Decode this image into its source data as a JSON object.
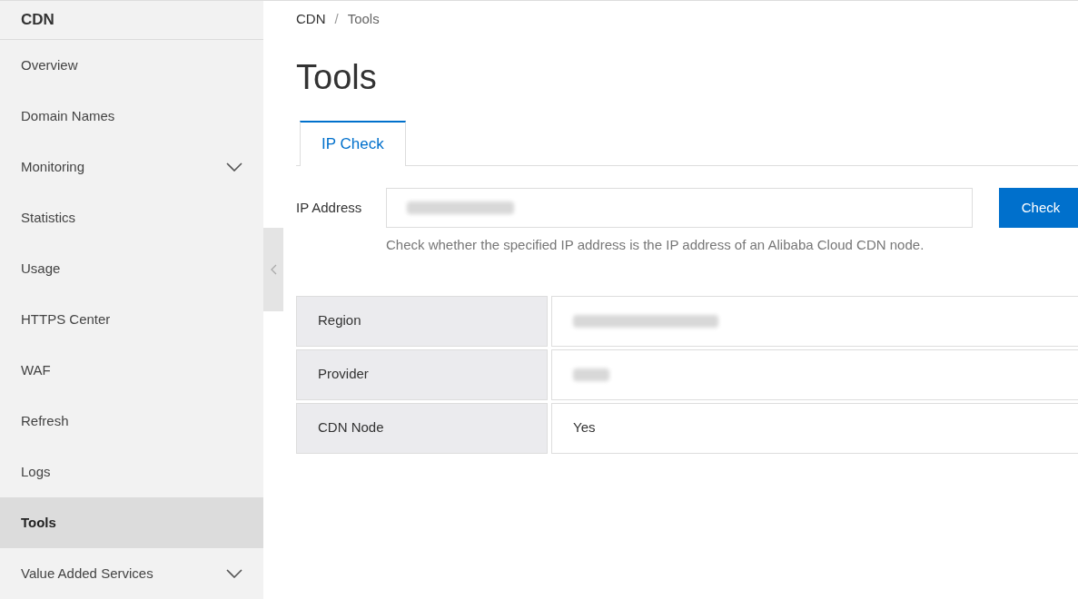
{
  "sidebar": {
    "title": "CDN",
    "items": [
      {
        "label": "Overview",
        "selected": false,
        "expandable": false
      },
      {
        "label": "Domain Names",
        "selected": false,
        "expandable": false
      },
      {
        "label": "Monitoring",
        "selected": false,
        "expandable": true
      },
      {
        "label": "Statistics",
        "selected": false,
        "expandable": false
      },
      {
        "label": "Usage",
        "selected": false,
        "expandable": false
      },
      {
        "label": "HTTPS Center",
        "selected": false,
        "expandable": false
      },
      {
        "label": "WAF",
        "selected": false,
        "expandable": false
      },
      {
        "label": "Refresh",
        "selected": false,
        "expandable": false
      },
      {
        "label": "Logs",
        "selected": false,
        "expandable": false
      },
      {
        "label": "Tools",
        "selected": true,
        "expandable": false
      },
      {
        "label": "Value Added Services",
        "selected": false,
        "expandable": true
      }
    ]
  },
  "breadcrumb": [
    "CDN",
    "Tools"
  ],
  "breadcrumb_separator": "/",
  "title": "Tools",
  "tabs": [
    {
      "label": "IP Check",
      "selected": true
    }
  ],
  "form": {
    "label": "IP Address",
    "value_redacted": true,
    "button": "Check",
    "hint": "Check whether the specified IP address is the IP address of an Alibaba Cloud CDN node."
  },
  "results": [
    {
      "label": "Region",
      "redacted": true
    },
    {
      "label": "Provider",
      "redacted": true
    },
    {
      "label": "CDN Node",
      "redacted": false,
      "value": "Yes"
    }
  ]
}
